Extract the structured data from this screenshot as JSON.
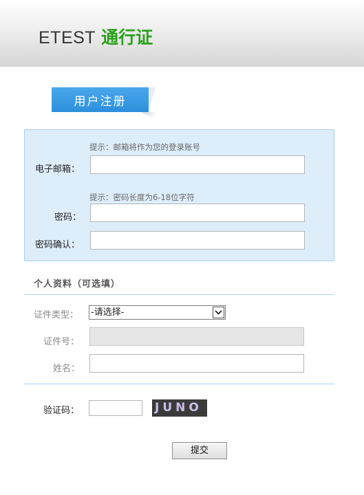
{
  "header": {
    "brand": "ETEST",
    "product": "通行证"
  },
  "form": {
    "tab_title": "用户注册",
    "email": {
      "hint": "提示：邮箱将作为您的登录账号",
      "label": "电子邮箱：",
      "value": ""
    },
    "password": {
      "hint": "提示：密码长度为6-18位字符",
      "label": "密码：",
      "value": ""
    },
    "password_confirm": {
      "label": "密码确认：",
      "value": ""
    }
  },
  "personal": {
    "title": "个人资料（可选填）",
    "id_type": {
      "label": "证件类型：",
      "selected": "-请选择-"
    },
    "id_number": {
      "label": "证件号：",
      "value": "",
      "disabled": true
    },
    "name": {
      "label": "姓名：",
      "value": ""
    }
  },
  "captcha": {
    "label": "验证码：",
    "value": "",
    "image_text": "JUNO"
  },
  "submit_label": "提交",
  "colors": {
    "brand_green": "#2aa11c",
    "tab_blue": "#2d8fdc",
    "box_bg": "#deedfa",
    "box_border": "#a9d1f2"
  }
}
